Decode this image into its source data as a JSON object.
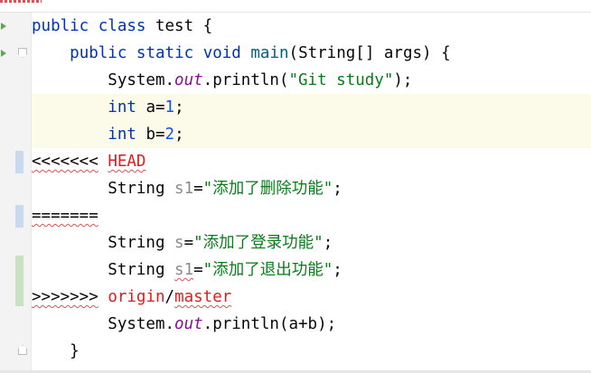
{
  "editor": {
    "lines": [
      {
        "id": "line-1",
        "tokens": [
          {
            "text": "public ",
            "style": "kw"
          },
          {
            "text": "class ",
            "style": "kw"
          },
          {
            "text": "test {",
            "style": "plain"
          }
        ]
      },
      {
        "id": "line-2",
        "tokens": [
          {
            "text": "    "
          },
          {
            "text": "public ",
            "style": "kw"
          },
          {
            "text": "static ",
            "style": "kw"
          },
          {
            "text": "void ",
            "style": "kw"
          },
          {
            "text": "main",
            "style": "fn"
          },
          {
            "text": "(String[] args) {",
            "style": "plain"
          }
        ]
      },
      {
        "id": "line-3",
        "tokens": [
          {
            "text": "        System."
          },
          {
            "text": "out",
            "style": "field"
          },
          {
            "text": ".println("
          },
          {
            "text": "\"Git study\"",
            "style": "str"
          },
          {
            "text": ");"
          }
        ]
      },
      {
        "id": "line-4",
        "tokens": [
          {
            "text": "        "
          },
          {
            "text": "int ",
            "style": "kw"
          },
          {
            "text": "a="
          },
          {
            "text": "1",
            "style": "num"
          },
          {
            "text": ";"
          }
        ]
      },
      {
        "id": "line-5",
        "tokens": [
          {
            "text": "        "
          },
          {
            "text": "int ",
            "style": "kw"
          },
          {
            "text": "b="
          },
          {
            "text": "2",
            "style": "num"
          },
          {
            "text": ";"
          }
        ]
      },
      {
        "id": "line-6",
        "tokens": [
          {
            "text": "<<<<<<<",
            "style": "marker",
            "wavy": true
          },
          {
            "text": " "
          },
          {
            "text": "HEAD",
            "style": "branch",
            "wavy": true
          }
        ]
      },
      {
        "id": "line-7",
        "tokens": [
          {
            "text": "        String "
          },
          {
            "text": "s1",
            "style": "unused"
          },
          {
            "text": "="
          },
          {
            "text": "\"添加了删除功能\"",
            "style": "str"
          },
          {
            "text": ";"
          }
        ]
      },
      {
        "id": "line-8",
        "tokens": [
          {
            "text": "=======",
            "style": "marker",
            "wavy": true
          }
        ]
      },
      {
        "id": "line-9",
        "tokens": [
          {
            "text": "        String "
          },
          {
            "text": "s",
            "style": "unused"
          },
          {
            "text": "="
          },
          {
            "text": "\"添加了登录功能\"",
            "style": "str"
          },
          {
            "text": ";"
          }
        ]
      },
      {
        "id": "line-10",
        "tokens": [
          {
            "text": "        String "
          },
          {
            "text": "s1",
            "style": "unused",
            "wavy": true
          },
          {
            "text": "="
          },
          {
            "text": "\"添加了退出功能\"",
            "style": "str"
          },
          {
            "text": ";"
          }
        ]
      },
      {
        "id": "line-11",
        "tokens": [
          {
            "text": ">>>>>>>",
            "style": "marker",
            "wavy": true
          },
          {
            "text": " "
          },
          {
            "text": "origin",
            "style": "branch"
          },
          {
            "text": "/"
          },
          {
            "text": "master",
            "style": "branch",
            "wavy": true
          }
        ]
      },
      {
        "id": "line-12",
        "tokens": [
          {
            "text": "        System."
          },
          {
            "text": "out",
            "style": "field"
          },
          {
            "text": ".println(a+b);"
          }
        ]
      },
      {
        "id": "line-13",
        "tokens": [
          {
            "text": "    }"
          }
        ]
      }
    ],
    "caret_lines": [
      4,
      5
    ]
  },
  "gutter": {
    "run_icon": "run-arrow-icon",
    "fold_icon": "fold-marker-icon",
    "markers": [
      {
        "line": 6,
        "kind": "modified",
        "color": "#c9d9f0"
      },
      {
        "line": 8,
        "kind": "modified",
        "color": "#c9d9f0"
      },
      {
        "line": 10,
        "kind": "added",
        "color": "#c8e2c3"
      },
      {
        "line": 11,
        "kind": "added",
        "color": "#c8e2c3"
      }
    ]
  },
  "colors": {
    "keyword": "#0033b3",
    "method": "#00627a",
    "field": "#871094",
    "string": "#067d17",
    "number": "#1750eb",
    "unused": "#8c8c8c",
    "branch": "#d91f1f",
    "caret_row": "#fcfae9"
  }
}
